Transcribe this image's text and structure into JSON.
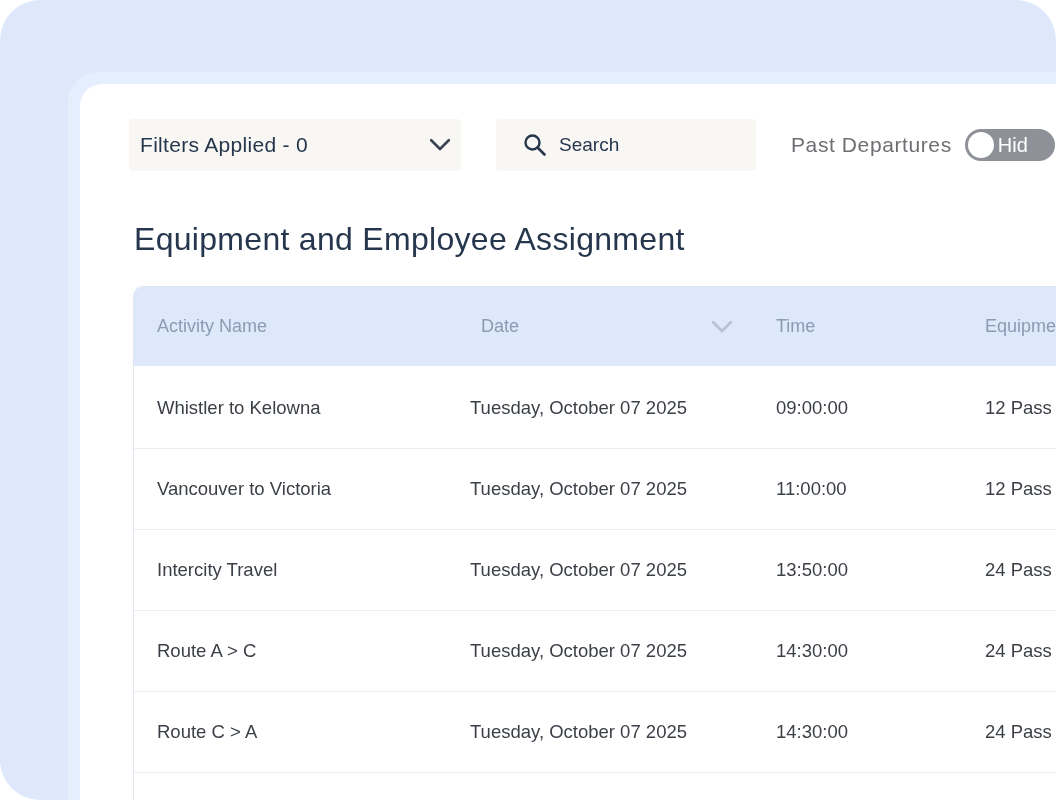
{
  "filters": {
    "label": "Filters Applied - 0"
  },
  "search": {
    "placeholder": "Search"
  },
  "past_departures": {
    "label": "Past Departures",
    "on": false,
    "state_text": "Hid"
  },
  "title": "Equipment and Employee Assignment",
  "table": {
    "columns": [
      {
        "label": "Activity Name",
        "sort_icon": false
      },
      {
        "label": "Date",
        "sort_icon": true
      },
      {
        "label": "Time",
        "sort_icon": false
      },
      {
        "label": "Equipme"
      }
    ],
    "rows": [
      [
        "Whistler to Kelowna",
        "Tuesday, October 07 2025",
        "09:00:00",
        "12 Pass"
      ],
      [
        "Vancouver to Victoria",
        "Tuesday, October 07 2025",
        "11:00:00",
        "12 Pass"
      ],
      [
        "Intercity Travel",
        "Tuesday, October 07 2025",
        "13:50:00",
        "24 Pass"
      ],
      [
        "Route A > C",
        "Tuesday, October 07 2025",
        "14:30:00",
        "24 Pass"
      ],
      [
        "Route C > A",
        "Tuesday, October 07 2025",
        "14:30:00",
        "24 Pass"
      ]
    ]
  }
}
